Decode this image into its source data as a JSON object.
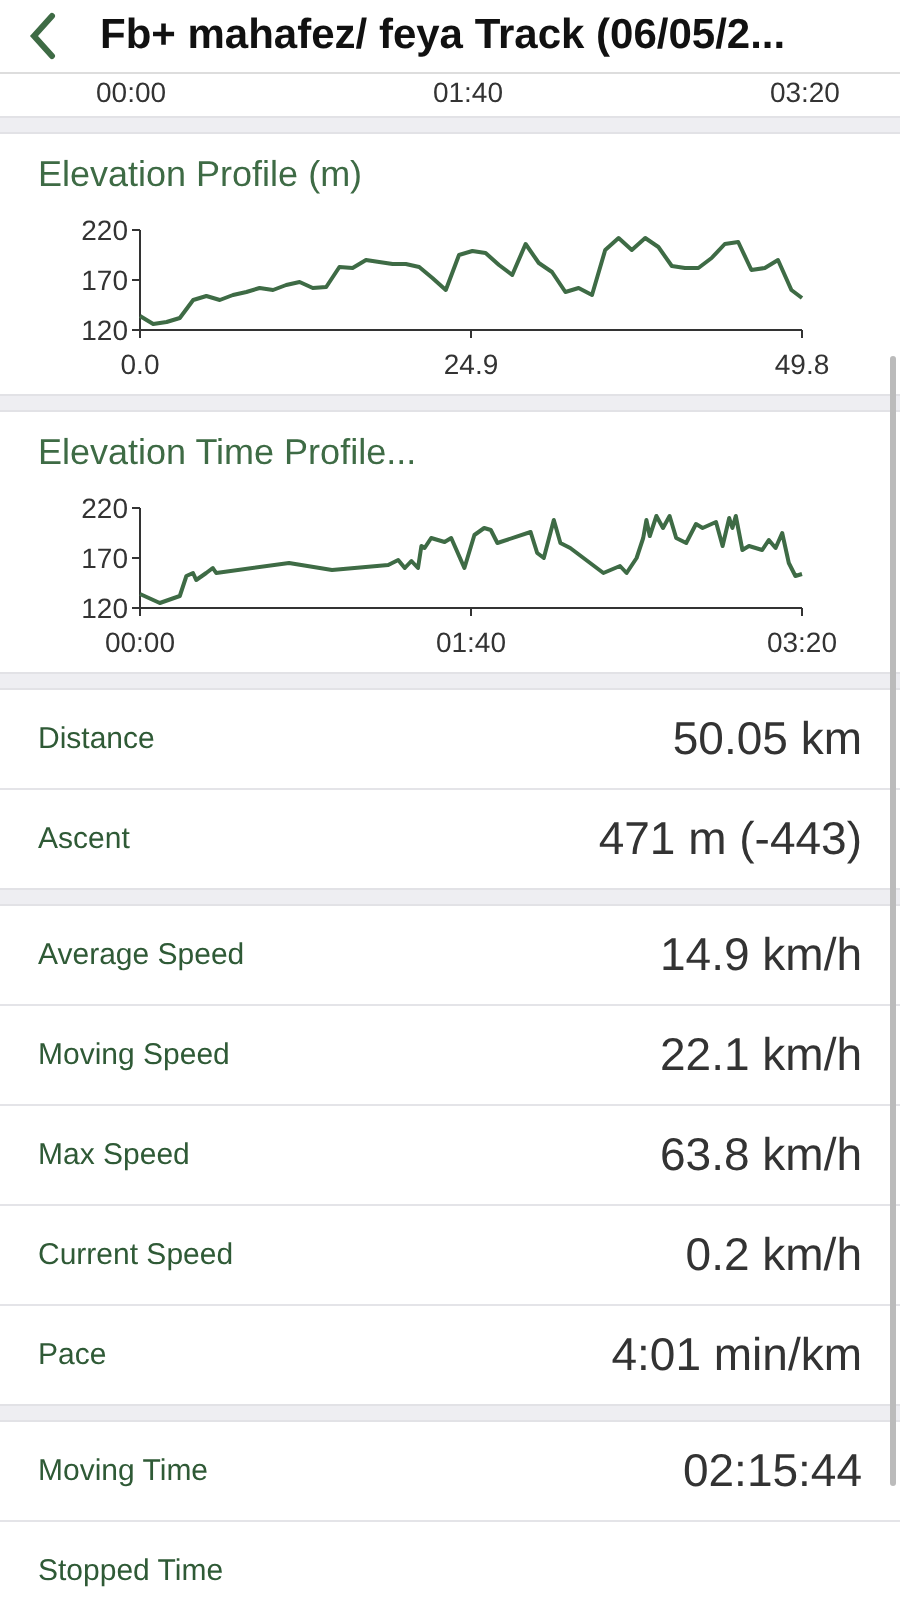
{
  "header": {
    "title": "Fb+ mahafez/ feya Track (06/05/2..."
  },
  "top_chart_axis": {
    "labels": [
      "00:00",
      "01:40",
      "03:20"
    ]
  },
  "charts": [
    {
      "title": "Elevation Profile (m)",
      "chart_data": {
        "type": "line",
        "x": [
          0,
          1,
          2,
          3,
          4,
          5,
          6,
          7,
          8,
          9,
          10,
          11,
          12,
          13,
          14,
          15,
          16,
          17,
          18,
          19,
          20,
          21,
          22,
          23,
          24,
          25,
          26,
          27,
          28,
          29,
          30,
          31,
          32,
          33,
          34,
          35,
          36,
          37,
          38,
          39,
          40,
          41,
          42,
          43,
          44,
          45,
          46,
          47,
          48,
          49,
          49.8
        ],
        "series": [
          {
            "color": "#3e6b45",
            "values": [
              134,
              126,
              128,
              132,
              150,
              154,
              150,
              155,
              158,
              162,
              160,
              165,
              168,
              162,
              163,
              183,
              182,
              190,
              188,
              186,
              186,
              183,
              172,
              160,
              195,
              199,
              197,
              185,
              175,
              206,
              187,
              178,
              158,
              162,
              155,
              200,
              212,
              200,
              212,
              203,
              184,
              182,
              182,
              192,
              206,
              208,
              180,
              182,
              190,
              160,
              152
            ]
          }
        ],
        "xlim": [
          0,
          49.8
        ],
        "ylim": [
          120,
          220
        ],
        "xticks": [
          {
            "value": 0,
            "label": "0.0"
          },
          {
            "value": 24.9,
            "label": "24.9"
          },
          {
            "value": 49.8,
            "label": "49.8"
          }
        ],
        "yticks": [
          120,
          170,
          220
        ]
      }
    },
    {
      "title": "Elevation Time Profile...",
      "chart_data": {
        "type": "line",
        "x": [
          0,
          6,
          12,
          14,
          16,
          17,
          20,
          22,
          23,
          45,
          58,
          75,
          78,
          80,
          82,
          84,
          85,
          86,
          88,
          92,
          94,
          98,
          101,
          104,
          106,
          108,
          118,
          120,
          122,
          125,
          127,
          130,
          140,
          145,
          147,
          150,
          152,
          153,
          154,
          156,
          158,
          160,
          162,
          165,
          168,
          170,
          174,
          176,
          178,
          179,
          180,
          182,
          184,
          188,
          190,
          192,
          194,
          196,
          198,
          200
        ],
        "series": [
          {
            "color": "#3e6b45",
            "values": [
              134,
              125,
              132,
              152,
              155,
              148,
              155,
              160,
              155,
              165,
              158,
              163,
              168,
              160,
              167,
              160,
              182,
              180,
              190,
              186,
              190,
              160,
              193,
              200,
              198,
              185,
              196,
              175,
              170,
              208,
              185,
              180,
              155,
              162,
              155,
              170,
              190,
              208,
              192,
              212,
              200,
              212,
              190,
              185,
              204,
              200,
              206,
              182,
              210,
              200,
              212,
              178,
              182,
              178,
              188,
              180,
              195,
              165,
              152,
              154
            ]
          }
        ],
        "xlim": [
          0,
          200
        ],
        "ylim": [
          120,
          220
        ],
        "xticks": [
          {
            "value": 0,
            "label": "00:00"
          },
          {
            "value": 100,
            "label": "01:40"
          },
          {
            "value": 200,
            "label": "03:20"
          }
        ],
        "yticks": [
          120,
          170,
          220
        ]
      }
    }
  ],
  "stat_groups": [
    [
      {
        "label": "Distance",
        "value": "50.05 km"
      },
      {
        "label": "Ascent",
        "value": "471 m (-443)"
      }
    ],
    [
      {
        "label": "Average Speed",
        "value": "14.9 km/h"
      },
      {
        "label": "Moving Speed",
        "value": "22.1 km/h"
      },
      {
        "label": "Max Speed",
        "value": "63.8 km/h"
      },
      {
        "label": "Current Speed",
        "value": "0.2 km/h"
      },
      {
        "label": "Pace",
        "value": "4:01 min/km"
      }
    ],
    [
      {
        "label": "Moving Time",
        "value": "02:15:44"
      },
      {
        "label": "Stopped Time"
      }
    ]
  ]
}
